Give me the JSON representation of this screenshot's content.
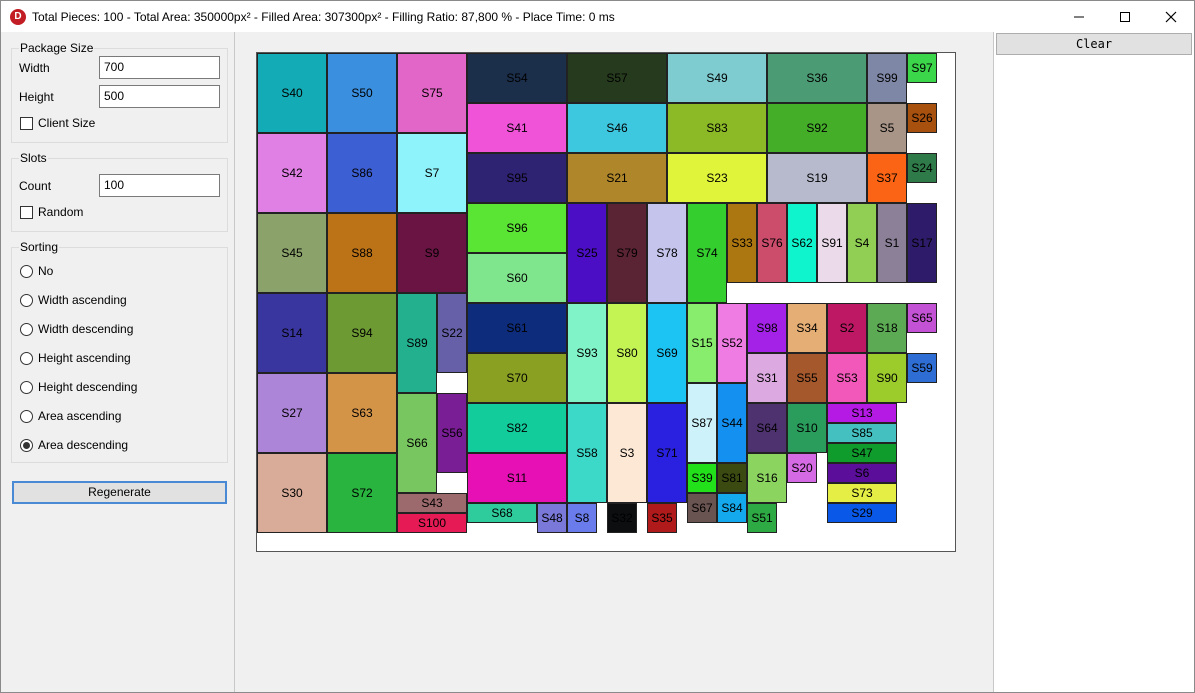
{
  "title": "Total Pieces: 100   -   Total Area: 350000px²   -   Filled Area: 307300px²   -   Filling Ratio: 87,800 %   -   Place Time: 0 ms",
  "app_icon_letter": "D",
  "package_size": {
    "title": "Package Size",
    "width_label": "Width",
    "width_value": "700",
    "height_label": "Height",
    "height_value": "500",
    "client_size_label": "Client Size"
  },
  "slots": {
    "title": "Slots",
    "count_label": "Count",
    "count_value": "100",
    "random_label": "Random"
  },
  "sorting": {
    "title": "Sorting",
    "options": [
      "No",
      "Width ascending",
      "Width descending",
      "Height ascending",
      "Height descending",
      "Area ascending",
      "Area descending"
    ],
    "selected": "Area descending"
  },
  "regenerate_label": "Regenerate",
  "clear_label": "Clear",
  "pieces": [
    {
      "label": "S40",
      "color": "#13acb6"
    },
    {
      "label": "S50",
      "color": "#3a8fde"
    },
    {
      "label": "S75",
      "color": "#e266c7"
    },
    {
      "label": "S54",
      "color": "#1b2e4a"
    },
    {
      "label": "S57",
      "color": "#263b1e"
    },
    {
      "label": "S49",
      "color": "#7ecbd0"
    },
    {
      "label": "S36",
      "color": "#4b9b74"
    },
    {
      "label": "S99",
      "color": "#7e87a5"
    },
    {
      "label": "S97",
      "color": "#3cd64a"
    },
    {
      "label": "S42",
      "color": "#e07fe4"
    },
    {
      "label": "S86",
      "color": "#3d5fd4"
    },
    {
      "label": "S7",
      "color": "#8ef3fa"
    },
    {
      "label": "S41",
      "color": "#f053d8"
    },
    {
      "label": "S46",
      "color": "#3ec8e0"
    },
    {
      "label": "S83",
      "color": "#8cba26"
    },
    {
      "label": "S92",
      "color": "#44ae29"
    },
    {
      "label": "S5",
      "color": "#a89588"
    },
    {
      "label": "S26",
      "color": "#a8500e"
    },
    {
      "label": "S95",
      "color": "#2e2272"
    },
    {
      "label": "S21",
      "color": "#b0862a"
    },
    {
      "label": "S23",
      "color": "#e0f43a"
    },
    {
      "label": "S19",
      "color": "#b6bacc"
    },
    {
      "label": "S37",
      "color": "#fa6414"
    },
    {
      "label": "S24",
      "color": "#2e7a48"
    },
    {
      "label": "S45",
      "color": "#8ba26a"
    },
    {
      "label": "S88",
      "color": "#bc7216"
    },
    {
      "label": "S9",
      "color": "#6a1444"
    },
    {
      "label": "S96",
      "color": "#5ae434"
    },
    {
      "label": "S25",
      "color": "#4b0ec4"
    },
    {
      "label": "S79",
      "color": "#5a2434"
    },
    {
      "label": "S78",
      "color": "#c4c4ec"
    },
    {
      "label": "S74",
      "color": "#34ce2e"
    },
    {
      "label": "S33",
      "color": "#ac7610"
    },
    {
      "label": "S76",
      "color": "#cc4c6c"
    },
    {
      "label": "S62",
      "color": "#10f4ce"
    },
    {
      "label": "S91",
      "color": "#eadaea"
    },
    {
      "label": "S4",
      "color": "#90ce54"
    },
    {
      "label": "S1",
      "color": "#8c8098"
    },
    {
      "label": "S17",
      "color": "#2e1c6a"
    },
    {
      "label": "S60",
      "color": "#80e68e"
    },
    {
      "label": "S14",
      "color": "#3a36a0"
    },
    {
      "label": "S94",
      "color": "#6e9a34"
    },
    {
      "label": "S89",
      "color": "#22b08e"
    },
    {
      "label": "S22",
      "color": "#6660a8"
    },
    {
      "label": "S61",
      "color": "#0d2c7c"
    },
    {
      "label": "S93",
      "color": "#80f4c8"
    },
    {
      "label": "S80",
      "color": "#c4f454"
    },
    {
      "label": "S69",
      "color": "#1cc4f4"
    },
    {
      "label": "S15",
      "color": "#88ec6c"
    },
    {
      "label": "S52",
      "color": "#ee7ce2"
    },
    {
      "label": "S98",
      "color": "#a422e8"
    },
    {
      "label": "S34",
      "color": "#e4ae74"
    },
    {
      "label": "S2",
      "color": "#be1864"
    },
    {
      "label": "S18",
      "color": "#5caa54"
    },
    {
      "label": "S65",
      "color": "#c452d4"
    },
    {
      "label": "S70",
      "color": "#8aa022"
    },
    {
      "label": "S31",
      "color": "#dcaae0"
    },
    {
      "label": "S55",
      "color": "#a4582c"
    },
    {
      "label": "S53",
      "color": "#f258ba"
    },
    {
      "label": "S90",
      "color": "#9ccc2c"
    },
    {
      "label": "S59",
      "color": "#2e6ed4"
    },
    {
      "label": "S27",
      "color": "#ac84d8"
    },
    {
      "label": "S63",
      "color": "#d49448"
    },
    {
      "label": "S66",
      "color": "#78c660"
    },
    {
      "label": "S56",
      "color": "#7a1e96"
    },
    {
      "label": "S82",
      "color": "#12cc9c"
    },
    {
      "label": "S58",
      "color": "#3cd8c8"
    },
    {
      "label": "S3",
      "color": "#fde8d6"
    },
    {
      "label": "S71",
      "color": "#2a20e0"
    },
    {
      "label": "S87",
      "color": "#cef2fa"
    },
    {
      "label": "S44",
      "color": "#1490f0"
    },
    {
      "label": "S64",
      "color": "#4e3270"
    },
    {
      "label": "S10",
      "color": "#2a9c5c"
    },
    {
      "label": "S13",
      "color": "#b41ae4"
    },
    {
      "label": "S85",
      "color": "#44c0c0"
    },
    {
      "label": "S47",
      "color": "#109c2c"
    },
    {
      "label": "S6",
      "color": "#5a0e9a"
    },
    {
      "label": "S73",
      "color": "#e4ee44"
    },
    {
      "label": "S29",
      "color": "#0a58e8"
    },
    {
      "label": "S30",
      "color": "#d8ac98"
    },
    {
      "label": "S72",
      "color": "#28b43e"
    },
    {
      "label": "S43",
      "color": "#9c6a6c"
    },
    {
      "label": "S100",
      "color": "#e61a54"
    },
    {
      "label": "S11",
      "color": "#e610b4"
    },
    {
      "label": "S68",
      "color": "#2ecc9c"
    },
    {
      "label": "S48",
      "color": "#7a78d8"
    },
    {
      "label": "S8",
      "color": "#6a7cec"
    },
    {
      "label": "S32",
      "color": "#0c0e10"
    },
    {
      "label": "S35",
      "color": "#b01a1a"
    },
    {
      "label": "S39",
      "color": "#22e01a"
    },
    {
      "label": "S81",
      "color": "#3a4a10"
    },
    {
      "label": "S67",
      "color": "#6a5452"
    },
    {
      "label": "S84",
      "color": "#14a8ec"
    },
    {
      "label": "S16",
      "color": "#8cd460"
    },
    {
      "label": "S20",
      "color": "#d46ae4"
    },
    {
      "label": "S51",
      "color": "#2eaa44"
    }
  ]
}
